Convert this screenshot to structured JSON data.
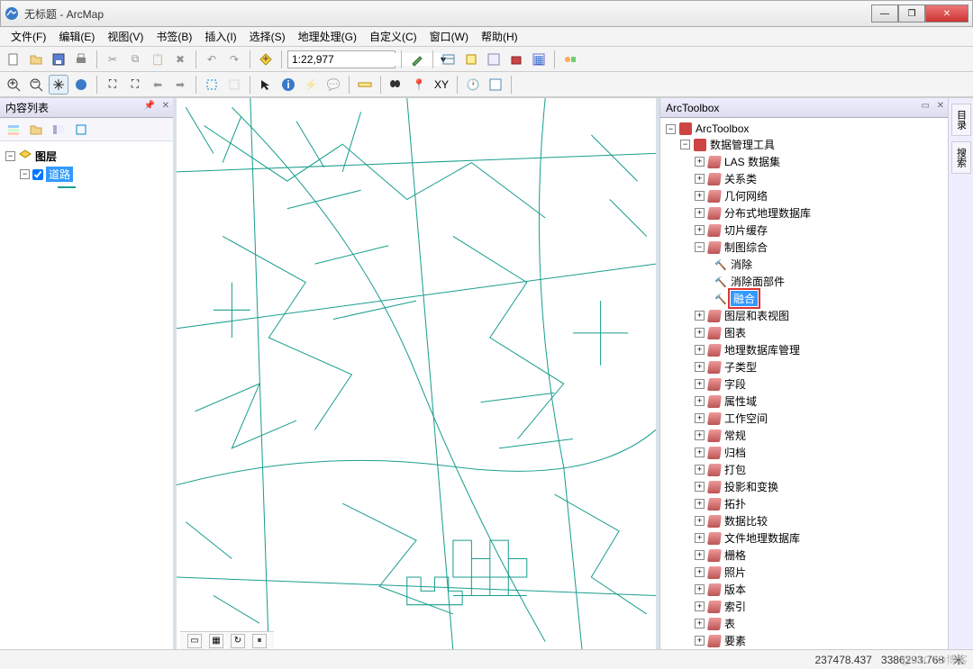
{
  "window": {
    "title": "无标题 - ArcMap",
    "min": "—",
    "max": "❐",
    "close": "✕"
  },
  "menu": {
    "items": [
      "文件(F)",
      "编辑(E)",
      "视图(V)",
      "书签(B)",
      "插入(I)",
      "选择(S)",
      "地理处理(G)",
      "自定义(C)",
      "窗口(W)",
      "帮助(H)"
    ]
  },
  "toolbar": {
    "scale_prefix": "1:",
    "scale_value": "22,977"
  },
  "toc": {
    "title": "内容列表",
    "root": "图层",
    "layer": "道路"
  },
  "arctoolbox": {
    "title": "ArcToolbox",
    "root": "ArcToolbox",
    "toolbox": "数据管理工具",
    "items": [
      "LAS 数据集",
      "关系类",
      "几何网络",
      "分布式地理数据库",
      "切片缓存",
      "制图综合"
    ],
    "cartography_tools": [
      "消除",
      "消除面部件",
      "融合"
    ],
    "rest": [
      "图层和表视图",
      "图表",
      "地理数据库管理",
      "子类型",
      "字段",
      "属性域",
      "工作空间",
      "常规",
      "归档",
      "打包",
      "投影和变换",
      "拓扑",
      "数据比较",
      "文件地理数据库",
      "栅格",
      "照片",
      "版本",
      "索引",
      "表",
      "要素"
    ]
  },
  "side_tabs": [
    "目录",
    "搜索"
  ],
  "status": {
    "x": "237478.437",
    "y": "3386293.768",
    "unit": "米"
  },
  "watermark": "@51CTO博客"
}
